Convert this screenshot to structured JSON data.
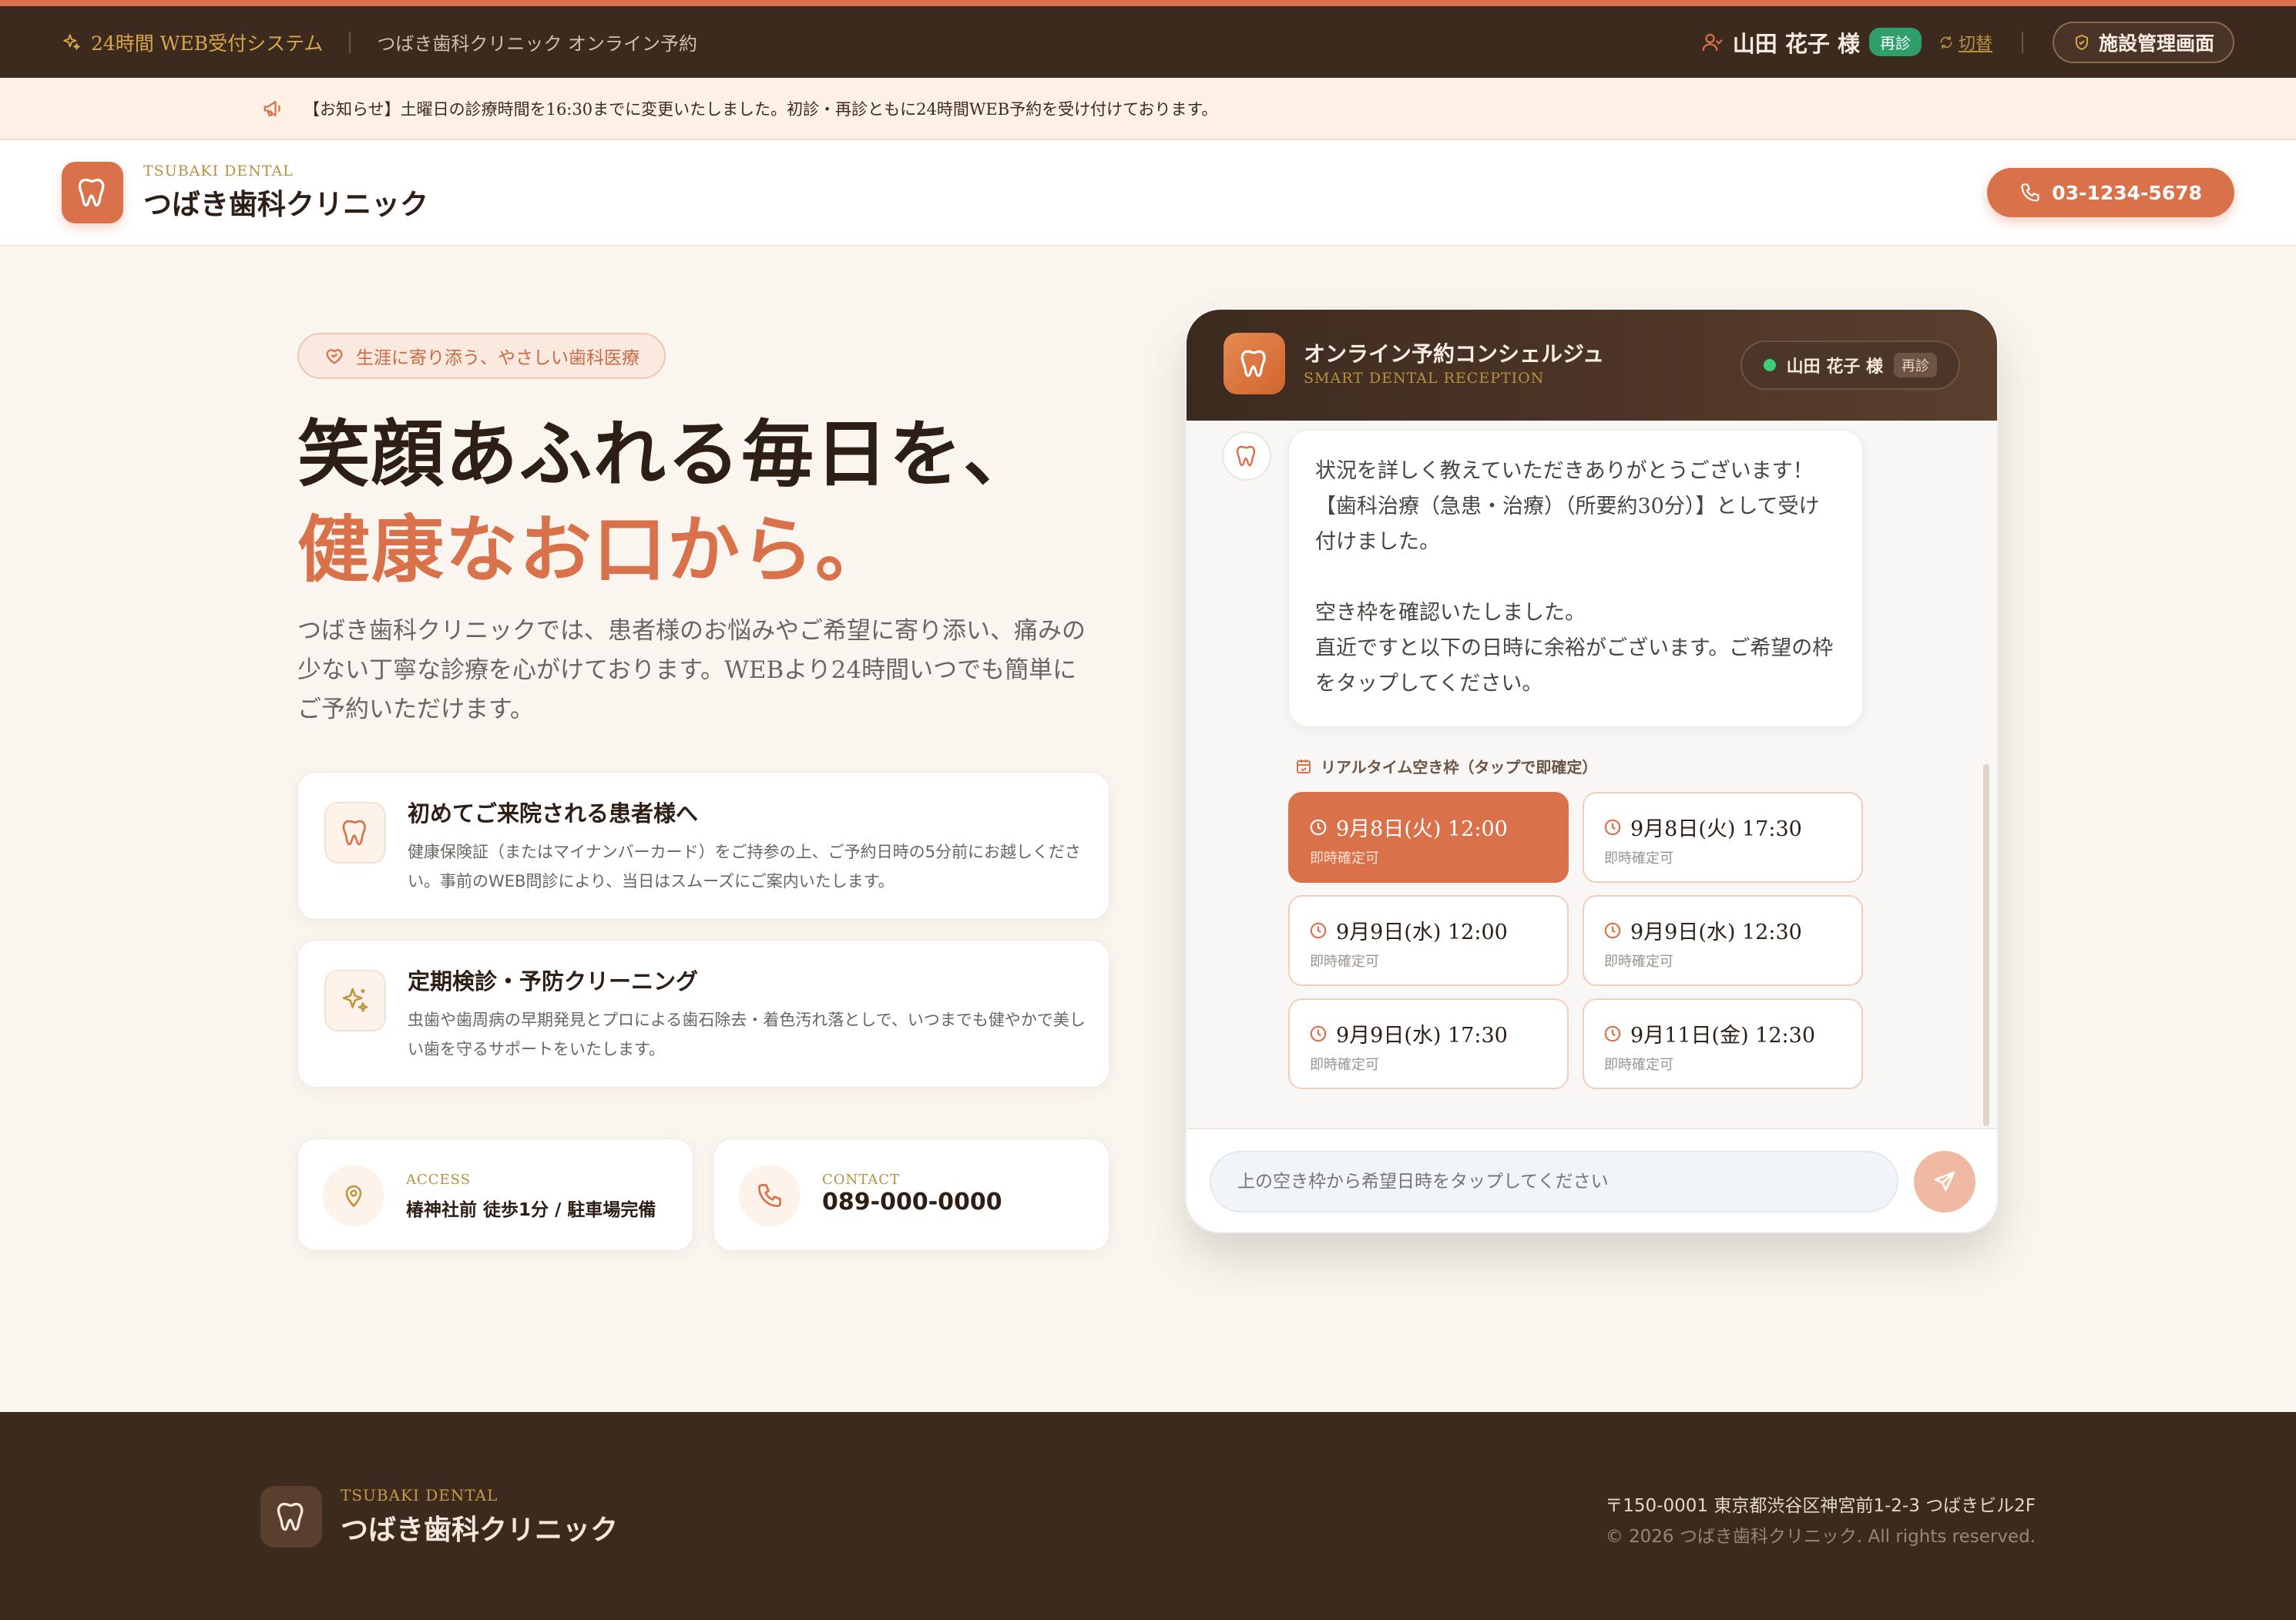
{
  "topbar": {
    "system_label": "24時間 WEB受付システム",
    "clinic_subtitle": "つばき歯科クリニック オンライン予約",
    "user_name": "山田 花子 様",
    "user_badge": "再診",
    "switch_label": "切替",
    "admin_button": "施設管理画面"
  },
  "notice": {
    "text": "【お知らせ】土曜日の診療時間を16:30までに変更いたしました。初診・再診ともに24時間WEB予約を受け付けております。"
  },
  "header": {
    "logo_en": "TSUBAKI DENTAL",
    "logo_ja": "つばき歯科クリニック",
    "phone": "03-1234-5678"
  },
  "hero": {
    "tagline": "生涯に寄り添う、やさしい歯科医療",
    "title_line1": "笑顔あふれる毎日を、",
    "title_line2": "健康なお口から。",
    "lead": "つばき歯科クリニックでは、患者様のお悩みやご希望に寄り添い、痛みの少ない丁寧な診療を心がけております。WEBより24時間いつでも簡単にご予約いただけます。"
  },
  "features": [
    {
      "title": "初めてご来院される患者様へ",
      "desc": "健康保険証（またはマイナンバーカード）をご持参の上、ご予約日時の5分前にお越しください。事前のWEB問診により、当日はスムーズにご案内いたします。"
    },
    {
      "title": "定期検診・予防クリーニング",
      "desc": "虫歯や歯周病の早期発見とプロによる歯石除去・着色汚れ落としで、いつまでも健やかで美しい歯を守るサポートをいたします。"
    }
  ],
  "info": {
    "access_label": "ACCESS",
    "access_value": "椿神社前 徒歩1分 / 駐車場完備",
    "contact_label": "CONTACT",
    "contact_value": "089-000-0000"
  },
  "chat": {
    "title": "オンライン予約コンシェルジュ",
    "subtitle": "SMART DENTAL RECEPTION",
    "user_name": "山田 花子 様",
    "user_badge": "再診",
    "message_lines": [
      "状況を詳しく教えていただきありがとうございます！",
      "【歯科治療（急患・治療）（所要約30分）】として受け付けました。",
      "",
      "空き枠を確認いたしました。",
      "直近ですと以下の日時に余裕がございます。ご希望の枠をタップしてください。"
    ],
    "slots_title": "リアルタイム空き枠（タップで即確定）",
    "slots": [
      {
        "time": "9月8日(火) 12:00",
        "sub": "即時確定可",
        "selected": true
      },
      {
        "time": "9月8日(火) 17:30",
        "sub": "即時確定可",
        "selected": false
      },
      {
        "time": "9月9日(水) 12:00",
        "sub": "即時確定可",
        "selected": false
      },
      {
        "time": "9月9日(水) 12:30",
        "sub": "即時確定可",
        "selected": false
      },
      {
        "time": "9月9日(水) 17:30",
        "sub": "即時確定可",
        "selected": false
      },
      {
        "time": "9月11日(金) 12:30",
        "sub": "即時確定可",
        "selected": false
      }
    ],
    "input_placeholder": "上の空き枠から希望日時をタップしてください"
  },
  "footer": {
    "logo_en": "TSUBAKI DENTAL",
    "logo_ja": "つばき歯科クリニック",
    "address": "〒150-0001 東京都渋谷区神宮前1-2-3 つばきビル2F",
    "copyright": "© 2026 つばき歯科クリニック. All rights reserved."
  },
  "colors": {
    "brand_brown": "#3d2a1f",
    "accent_orange": "#d9714a",
    "gold": "#b8913f",
    "badge_green": "#2f9e6a",
    "page_bg": "#faf6ef"
  },
  "icons": {
    "topbar": "sparkles-icon",
    "user": "user-icon",
    "switch": "refresh-icon",
    "admin": "shield-icon",
    "notice": "megaphone-icon",
    "logo": "tooth-icon",
    "phone": "phone-icon",
    "tagline": "heart-icon",
    "access": "map-pin-icon",
    "calendar": "calendar-icon",
    "clock": "clock-icon",
    "send": "send-icon"
  }
}
